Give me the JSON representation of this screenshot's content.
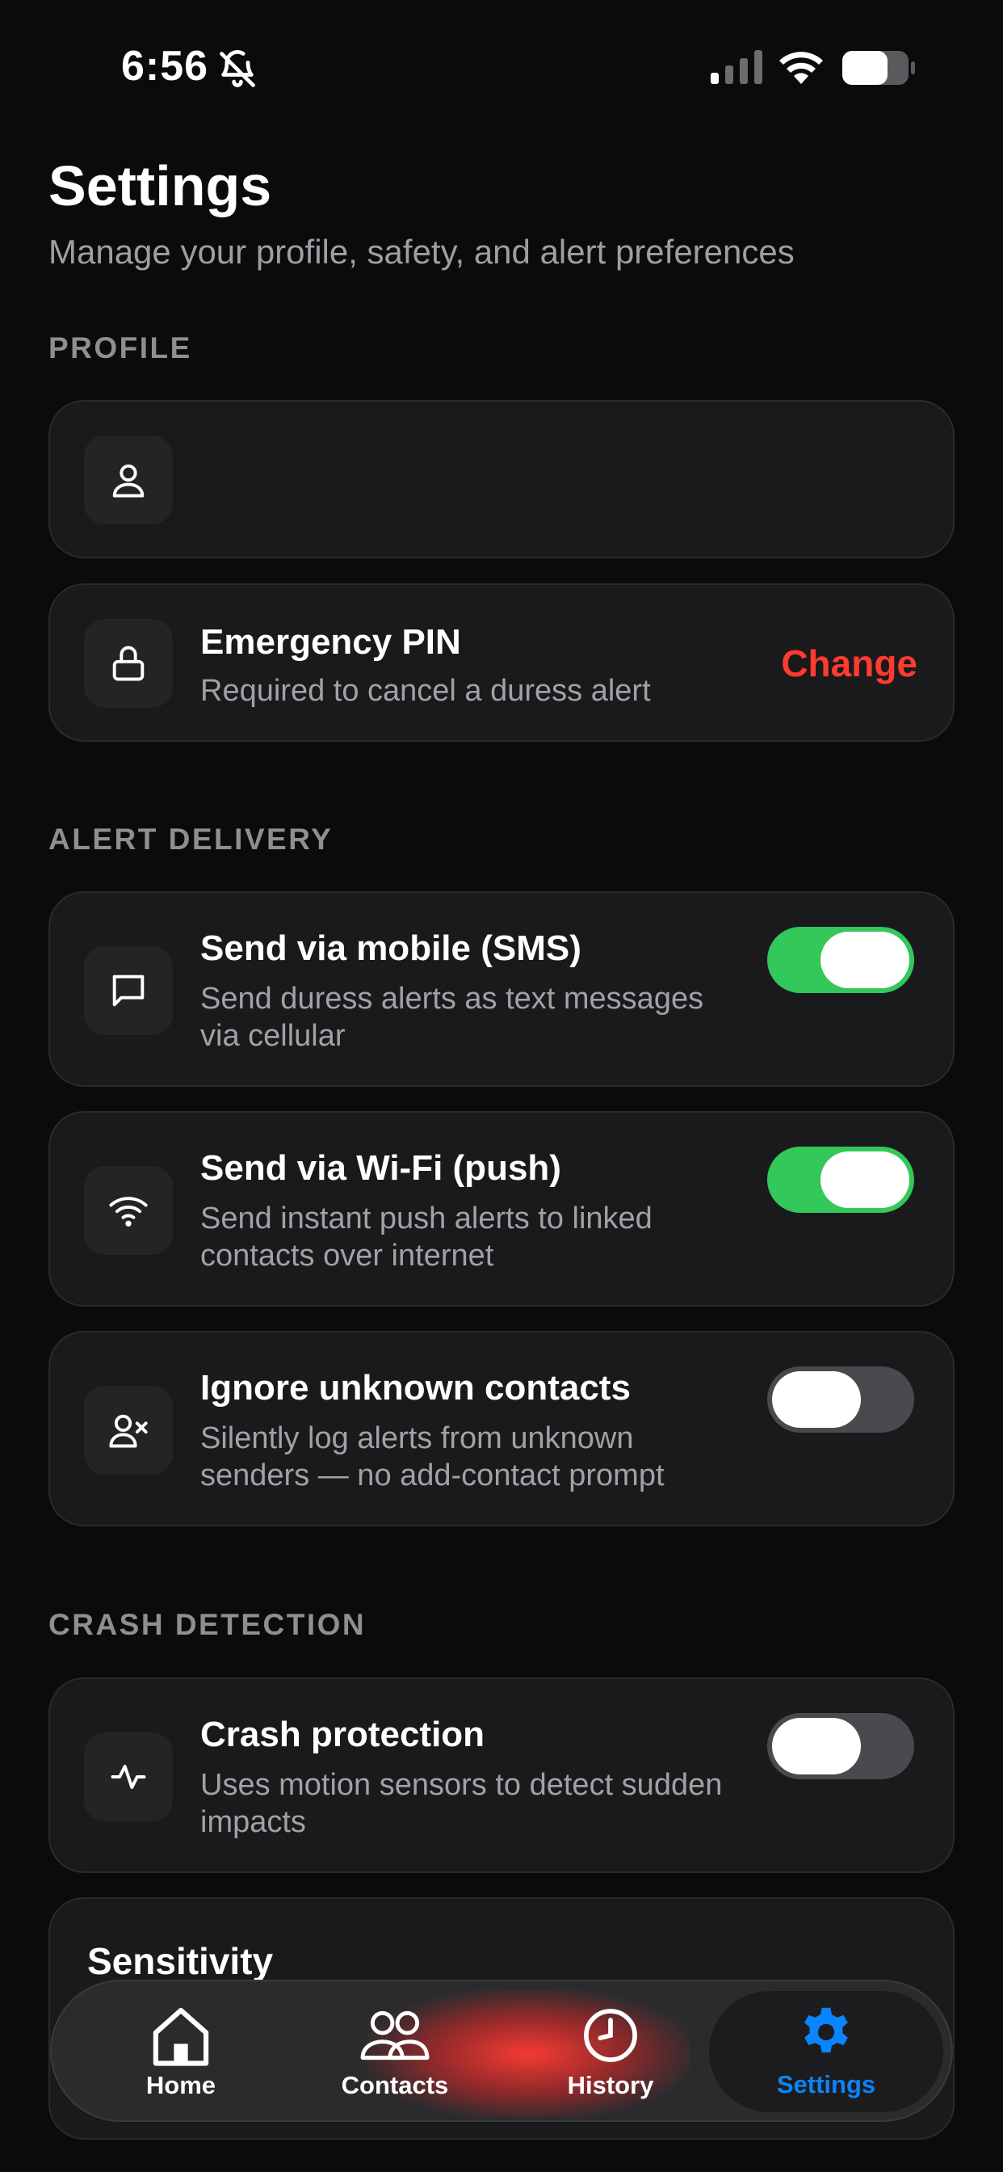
{
  "status_bar": {
    "time": "6:56"
  },
  "header": {
    "title": "Settings",
    "subtitle": "Manage your profile, safety, and alert preferences"
  },
  "sections": {
    "profile": "PROFILE",
    "alert_delivery": "ALERT DELIVERY",
    "crash_detection": "CRASH DETECTION"
  },
  "profile": {
    "user_icon": "user-icon",
    "pin": {
      "title": "Emergency PIN",
      "description": "Required to cancel a duress alert",
      "action": "Change",
      "icon": "lock-icon"
    }
  },
  "alert_delivery": {
    "sms": {
      "title": "Send via mobile (SMS)",
      "description": "Send duress alerts as text messages via cellular",
      "enabled": true,
      "icon": "message-icon"
    },
    "push": {
      "title": "Send via Wi-Fi (push)",
      "description": "Send instant push alerts to linked contacts over internet",
      "enabled": true,
      "icon": "wifi-icon"
    },
    "ignore_unknown": {
      "title": "Ignore unknown contacts",
      "description": "Silently log alerts from unknown senders — no add-contact prompt",
      "enabled": false,
      "icon": "user-x-icon"
    }
  },
  "crash_detection": {
    "protection": {
      "title": "Crash protection",
      "description": "Uses motion sensors to detect sudden impacts",
      "enabled": false,
      "icon": "activity-icon"
    },
    "sensitivity": {
      "title": "Sensitivity"
    }
  },
  "tab_bar": {
    "tabs": [
      {
        "label": "Home",
        "icon": "home-icon"
      },
      {
        "label": "Contacts",
        "icon": "users-icon"
      },
      {
        "label": "History",
        "icon": "clock-icon"
      },
      {
        "label": "Settings",
        "icon": "gear-icon",
        "active": true
      }
    ]
  },
  "colors": {
    "accent_red": "#ff3b30",
    "toggle_on": "#34c759",
    "active_tab": "#0a84ff"
  }
}
